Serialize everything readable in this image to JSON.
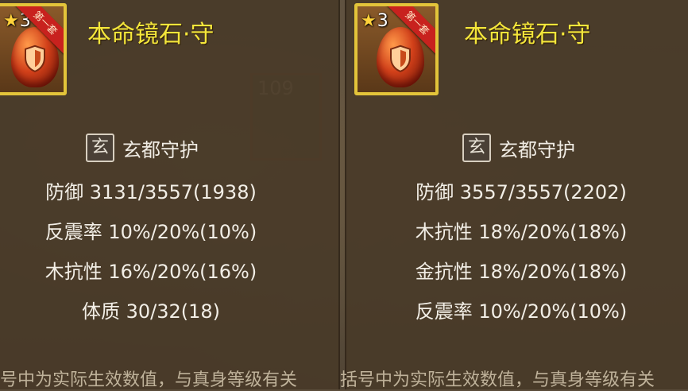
{
  "background": {
    "card_level": "109"
  },
  "panels": [
    {
      "id": "left",
      "star_count": "3",
      "ribbon_label": "第一套",
      "item_name": "本命镜石·守",
      "set_badge": "玄",
      "set_name": "玄都守护",
      "stats": [
        "防御 3131/3557(1938)",
        "反震率 10%/20%(10%)",
        "木抗性 16%/20%(16%)",
        "体质 30/32(18)"
      ],
      "footer": "号中为实际生效数值，与真身等级有关"
    },
    {
      "id": "right",
      "star_count": "3",
      "ribbon_label": "第一套",
      "item_name": "本命镜石·守",
      "set_badge": "玄",
      "set_name": "玄都守护",
      "stats": [
        "防御 3557/3557(2202)",
        "木抗性 18%/20%(18%)",
        "金抗性 18%/20%(18%)",
        "反震率 10%/20%(10%)"
      ],
      "footer": "括号中为实际生效数值，与真身等级有关"
    }
  ],
  "colors": {
    "name_yellow": "#f4e63b",
    "frame_gold": "#e3c43a",
    "ribbon_red": "#c8221e"
  },
  "icons": {
    "star": "star-icon",
    "gem": "shield-gem-icon"
  }
}
